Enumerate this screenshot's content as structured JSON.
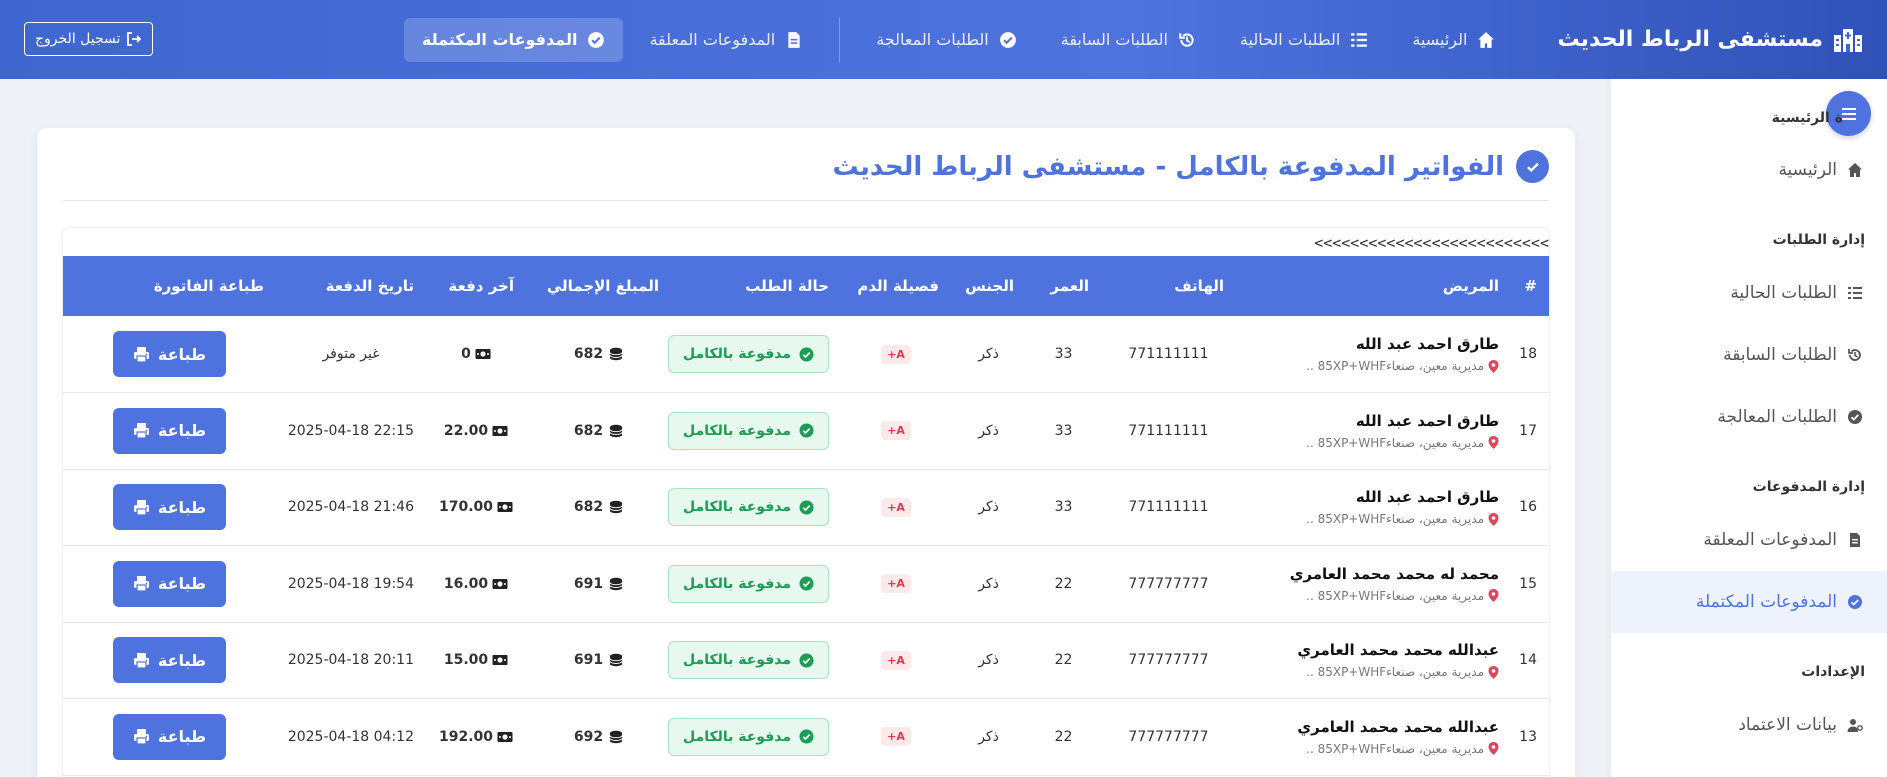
{
  "app": {
    "brand": "مستشفى الرباط الحديث",
    "logout_label": "تسجيل الخروج"
  },
  "nav": [
    {
      "label": "الرئيسية",
      "icon": "home-icon",
      "active": false
    },
    {
      "label": "الطلبات الحالية",
      "icon": "list-icon",
      "active": false
    },
    {
      "label": "الطلبات السابقة",
      "icon": "history-icon",
      "active": false
    },
    {
      "label": "الطلبات المعالجة",
      "icon": "check-circle-icon",
      "active": false
    },
    {
      "label": "المدفوعات المعلقة",
      "icon": "file-icon",
      "active": false
    },
    {
      "label": "المدفوعات المكتملة",
      "icon": "check-circle-icon",
      "active": true
    }
  ],
  "sidebar": {
    "section_home": "ة الرئيسية",
    "home": "الرئيسية",
    "section_orders": "إدارة الطلبات",
    "orders_current": "الطلبات الحالية",
    "orders_previous": "الطلبات السابقة",
    "orders_processed": "الطلبات المعالجة",
    "section_payments": "إدارة المدفوعات",
    "payments_pending": "المدفوعات المعلقة",
    "payments_completed": "المدفوعات المكتملة",
    "section_settings": "الإعدادات",
    "credentials": "بيانات الاعتماد"
  },
  "page": {
    "title": "الفواتير المدفوعة بالكامل - مستشفى الرباط الحديث",
    "scroll_hint": "<<<<<<<<<<<<<<<<<<<<<<<<<<"
  },
  "table": {
    "headers": [
      "#",
      "المريض",
      "الهاتف",
      "العمر",
      "الجنس",
      "فصيلة الدم",
      "حالة الطلب",
      "المبلغ الإجمالي",
      "آخر دفعة",
      "تاريخ الدفعة",
      "طباعة الفاتورة"
    ],
    "print_label": "طباعة",
    "rows": [
      {
        "id": "18",
        "name": "طارق احمد عبد الله",
        "location": "مديرية معين، صنعاء85XP+WHF ..",
        "phone": "771111111",
        "age": "33",
        "gender": "ذكر",
        "blood": "A+",
        "status": "مدفوعة بالكامل",
        "total": "682",
        "last_payment": "0",
        "payment_date": "غير متوفر"
      },
      {
        "id": "17",
        "name": "طارق احمد عبد الله",
        "location": "مديرية معين، صنعاء85XP+WHF ..",
        "phone": "771111111",
        "age": "33",
        "gender": "ذكر",
        "blood": "A+",
        "status": "مدفوعة بالكامل",
        "total": "682",
        "last_payment": "22.00",
        "payment_date": "2025-04-18 22:15"
      },
      {
        "id": "16",
        "name": "طارق احمد عبد الله",
        "location": "مديرية معين، صنعاء85XP+WHF ..",
        "phone": "771111111",
        "age": "33",
        "gender": "ذكر",
        "blood": "A+",
        "status": "مدفوعة بالكامل",
        "total": "682",
        "last_payment": "170.00",
        "payment_date": "2025-04-18 21:46"
      },
      {
        "id": "15",
        "name": "محمد له محمد محمد العامري",
        "location": "مديرية معين، صنعاء85XP+WHF ..",
        "phone": "777777777",
        "age": "22",
        "gender": "ذكر",
        "blood": "A+",
        "status": "مدفوعة بالكامل",
        "total": "691",
        "last_payment": "16.00",
        "payment_date": "2025-04-18 19:54"
      },
      {
        "id": "14",
        "name": "عبدالله محمد محمد العامري",
        "location": "مديرية معين، صنعاء85XP+WHF ..",
        "phone": "777777777",
        "age": "22",
        "gender": "ذكر",
        "blood": "A+",
        "status": "مدفوعة بالكامل",
        "total": "691",
        "last_payment": "15.00",
        "payment_date": "2025-04-18 20:11"
      },
      {
        "id": "13",
        "name": "عبدالله محمد محمد العامري",
        "location": "مديرية معين، صنعاء85XP+WHF ..",
        "phone": "777777777",
        "age": "22",
        "gender": "ذكر",
        "blood": "A+",
        "status": "مدفوعة بالكامل",
        "total": "692",
        "last_payment": "192.00",
        "payment_date": "2025-04-18 04:12"
      }
    ]
  },
  "colors": {
    "primary": "#4e73df",
    "success": "#1c9c54",
    "danger": "#d93c4f"
  }
}
